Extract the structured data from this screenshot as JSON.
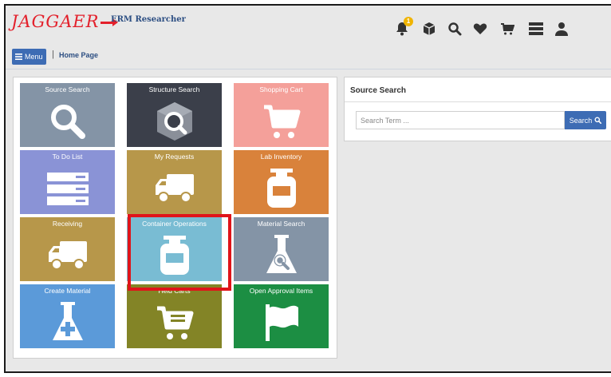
{
  "header": {
    "logo_text": "JAGGAER",
    "app_title": "ERM Researcher",
    "notification_count": "1",
    "icons": [
      "bell-icon",
      "box-icon",
      "search-icon",
      "heart-icon",
      "cart-icon",
      "server-icon",
      "user-icon"
    ]
  },
  "nav": {
    "menu_label": "Menu",
    "separator": "|",
    "breadcrumb": "Home Page"
  },
  "tiles": [
    {
      "label": "Source Search",
      "color": "#8494a6",
      "icon": "magnifier-icon"
    },
    {
      "label": "Structure Search",
      "color": "#3b3f4a",
      "icon": "cube-search-icon"
    },
    {
      "label": "Shopping Cart",
      "color": "#f4a09a",
      "icon": "cart-icon"
    },
    {
      "label": "To Do List",
      "color": "#8a93d6",
      "icon": "list-icon"
    },
    {
      "label": "My Requests",
      "color": "#b7974a",
      "icon": "truck-icon"
    },
    {
      "label": "Lab Inventory",
      "color": "#d9823b",
      "icon": "bottle-icon"
    },
    {
      "label": "Receiving",
      "color": "#b7974a",
      "icon": "truck-icon"
    },
    {
      "label": "Container Operations",
      "color": "#79bcd3",
      "icon": "bottle-icon"
    },
    {
      "label": "Material Search",
      "color": "#8494a6",
      "icon": "flask-search-icon"
    },
    {
      "label": "Create Material",
      "color": "#5b9ad9",
      "icon": "flask-plus-icon"
    },
    {
      "label": "Held Carts",
      "color": "#838426",
      "icon": "cart-list-icon"
    },
    {
      "label": "Open Approval Items",
      "color": "#1c8e43",
      "icon": "flag-icon"
    }
  ],
  "source_search": {
    "title": "Source Search",
    "placeholder": "Search Term ...",
    "value": "",
    "button_label": "Search"
  },
  "colors": {
    "accent": "#3d6cb4",
    "brand": "#e3202b",
    "highlight": "#e0141a"
  }
}
